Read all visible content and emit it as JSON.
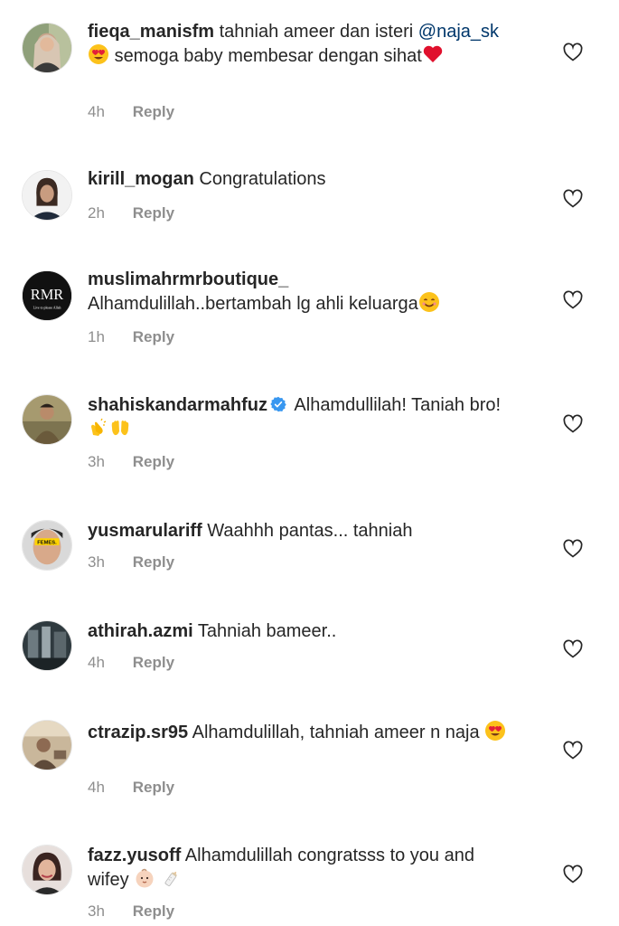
{
  "reply_label": "Reply",
  "comments": [
    {
      "username": "fieqa_manisfm",
      "text_before": "tahniah ameer dan isteri",
      "mention": "@naja_sk",
      "text_after": "semoga baby membesar dengan sihat",
      "time": "4h"
    },
    {
      "username": "kirill_mogan",
      "text": "Congratulations",
      "time": "2h"
    },
    {
      "username": "muslimahrmrboutique_",
      "text": "Alhamdulillah..bertambah lg ahli keluarga",
      "time": "1h",
      "avatar_logo": "RMR",
      "avatar_tagline": "Live to please Allah"
    },
    {
      "username": "shahiskandarmahfuz",
      "text": "Alhamdullilah! Taniah bro!",
      "time": "3h",
      "verified": true
    },
    {
      "username": "yusmarulariff",
      "text": "Waahhh pantas... tahniah",
      "time": "3h",
      "avatar_badge": "FEMES."
    },
    {
      "username": "athirah.azmi",
      "text": "Tahniah bameer..",
      "time": "4h"
    },
    {
      "username": "ctrazip.sr95",
      "text": "Alhamdulillah, tahniah ameer n naja",
      "time": "4h"
    },
    {
      "username": "fazz.yusoff",
      "text": "Alhamdulillah congratsss to you and wifey",
      "time": "3h"
    }
  ],
  "icons": {
    "like": "heart-outline-icon",
    "verified": "verified-badge-icon"
  },
  "colors": {
    "username": "#262626",
    "mention": "#00376b",
    "meta": "#8e8e8e",
    "verified": "#3897f0"
  }
}
